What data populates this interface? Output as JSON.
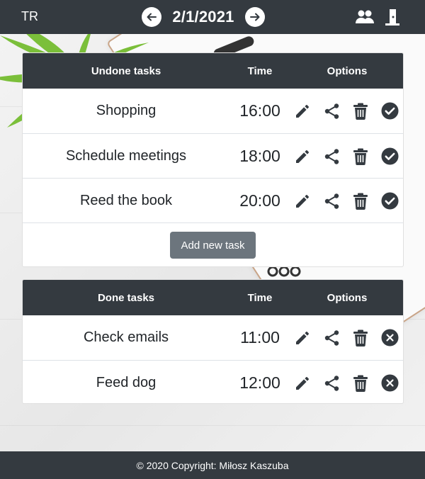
{
  "navbar": {
    "brand": "TR",
    "date": "2/1/2021",
    "prev_icon": "arrow-left-icon",
    "next_icon": "arrow-right-icon",
    "users_icon": "users-icon",
    "logout_icon": "door-exit-icon"
  },
  "undone": {
    "headers": {
      "name": "Undone tasks",
      "time": "Time",
      "options": "Options"
    },
    "tasks": [
      {
        "name": "Shopping",
        "time": "16:00"
      },
      {
        "name": "Schedule meetings",
        "time": "18:00"
      },
      {
        "name": "Reed the book",
        "time": "20:00"
      }
    ],
    "add_label": "Add new task"
  },
  "done": {
    "headers": {
      "name": "Done tasks",
      "time": "Time",
      "options": "Options"
    },
    "tasks": [
      {
        "name": "Check emails",
        "time": "11:00"
      },
      {
        "name": "Feed dog",
        "time": "12:00"
      }
    ]
  },
  "footer": {
    "text": "© 2020 Copyright: Miłosz Kaszuba"
  },
  "colors": {
    "dark": "#343a40",
    "secondary_button": "#6c757d",
    "icon": "#343a40"
  }
}
